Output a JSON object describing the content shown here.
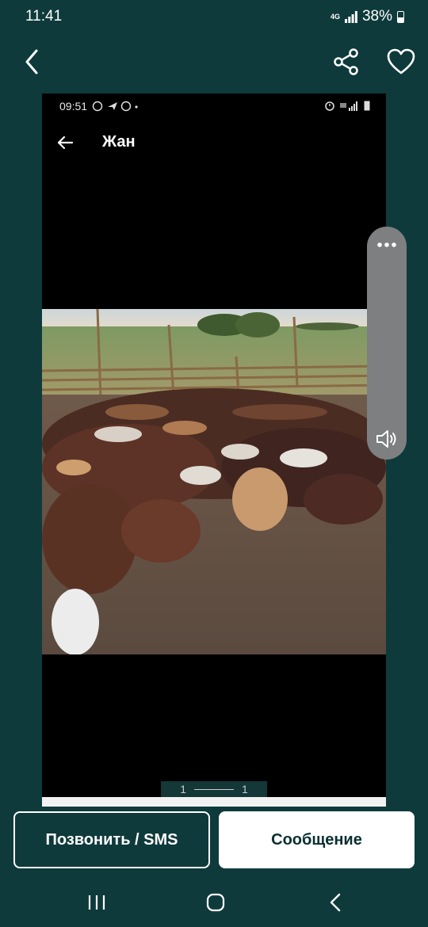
{
  "status_bar": {
    "time": "11:41",
    "network": "4G",
    "battery": "38%"
  },
  "top_bar": {
    "back_icon": "back-arrow-icon",
    "share_icon": "share-icon",
    "favorite_icon": "heart-icon"
  },
  "viewer": {
    "inner_status": {
      "time": "09:51"
    },
    "inner_title": "Жан",
    "page_counter": {
      "current": "1",
      "total": "1"
    }
  },
  "side_panel": {
    "more_icon": "more-dots-icon",
    "volume_icon": "volume-icon"
  },
  "actions": {
    "call_label": "Позвонить / SMS",
    "message_label": "Сообщение"
  },
  "colors": {
    "background": "#0f3a3c",
    "message_text": "#0a2f31"
  }
}
